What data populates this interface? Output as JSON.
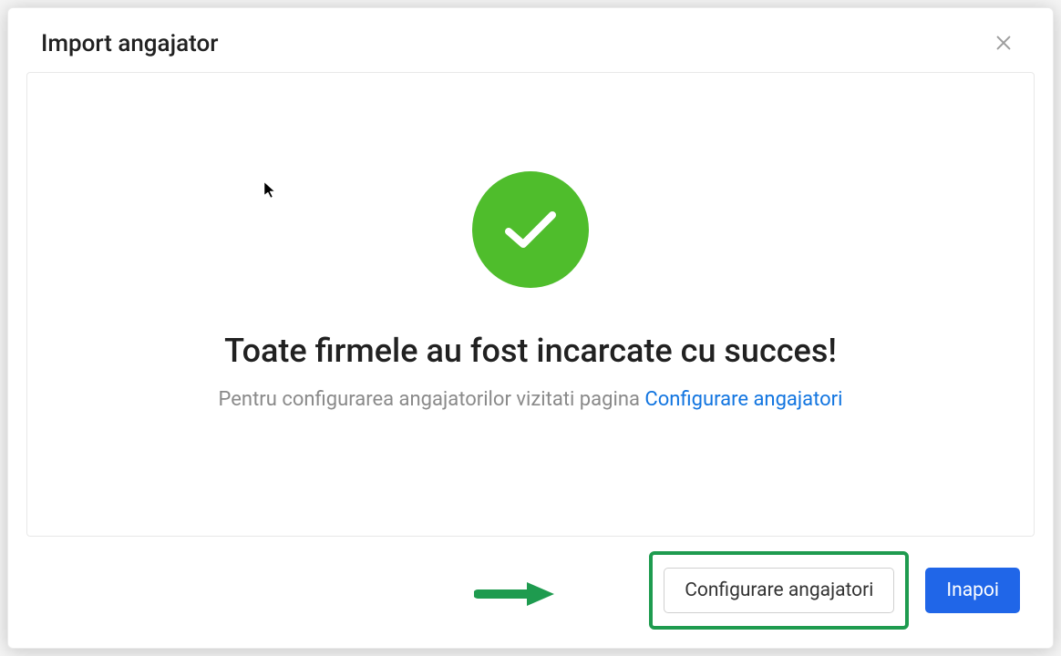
{
  "modal": {
    "title": "Import angajator",
    "success_heading": "Toate firmele au fost incarcate cu succes!",
    "subtext_prefix": "Pentru configurarea angajatorilor vizitati pagina ",
    "subtext_link": "Configurare angajatori",
    "buttons": {
      "configure": "Configurare angajatori",
      "back": "Inapoi"
    }
  },
  "colors": {
    "success_green": "#4fbd2c",
    "highlight_green": "#1e9b4f",
    "primary_blue": "#2066e8",
    "link_blue": "#1275e0"
  }
}
